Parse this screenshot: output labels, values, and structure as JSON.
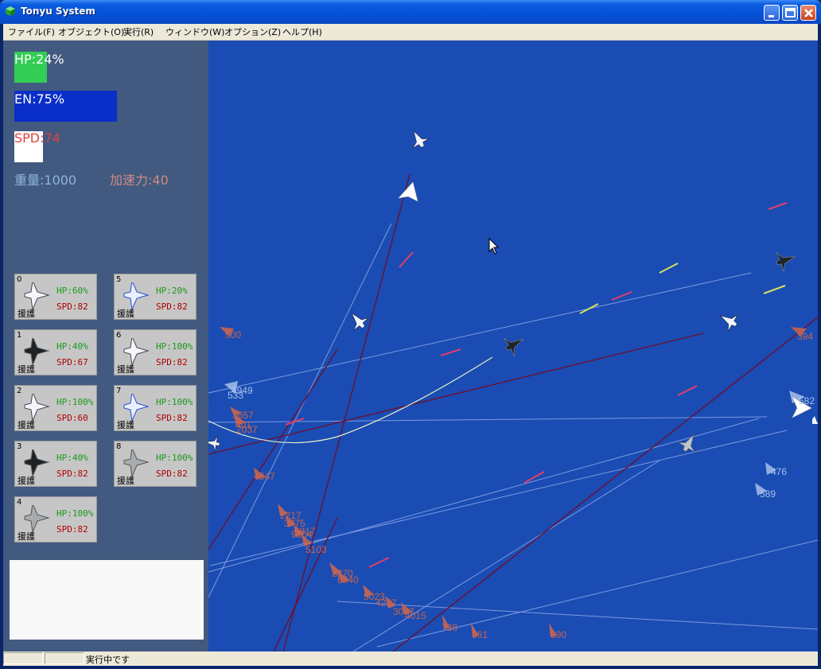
{
  "window": {
    "title": "Tonyu System"
  },
  "menu": [
    {
      "label": "ファイル(F)"
    },
    {
      "label": "オブジェクト(O)"
    },
    {
      "label": "実行(R)"
    },
    {
      "label": "ウィンドウ(W)"
    },
    {
      "label": "オプション(Z)"
    },
    {
      "label": "ヘルプ(H)"
    }
  ],
  "status": {
    "text": "実行中です"
  },
  "hud": {
    "hp": {
      "label": "HP:24%",
      "value": 24,
      "color": "#33cc55"
    },
    "en": {
      "label": "EN:75%",
      "value": 75,
      "color": "#0a2ec8"
    },
    "spd": {
      "label": "SPD:74",
      "value": 74,
      "color": "#ffffff"
    },
    "weight": "重量:1000",
    "accel": "加速力:40"
  },
  "units": [
    {
      "num": "0",
      "hp": "HP:60%",
      "spd": "SPD:82",
      "role": "援護",
      "icon": "white-fighter-icon"
    },
    {
      "num": "5",
      "hp": "HP:20%",
      "spd": "SPD:82",
      "role": "援護",
      "icon": "blue-fighter-icon"
    },
    {
      "num": "1",
      "hp": "HP:40%",
      "spd": "SPD:67",
      "role": "援護",
      "icon": "black-fighter-icon"
    },
    {
      "num": "6",
      "hp": "HP:100%",
      "spd": "SPD:82",
      "role": "援護",
      "icon": "white-fighter-icon"
    },
    {
      "num": "2",
      "hp": "HP:100%",
      "spd": "SPD:60",
      "role": "援護",
      "icon": "white-fighter-icon"
    },
    {
      "num": "7",
      "hp": "HP:100%",
      "spd": "SPD:82",
      "role": "援護",
      "icon": "blue-fighter-icon"
    },
    {
      "num": "3",
      "hp": "HP:40%",
      "spd": "SPD:82",
      "role": "援護",
      "icon": "black-fighter-icon"
    },
    {
      "num": "8",
      "hp": "HP:100%",
      "spd": "SPD:82",
      "role": "援護",
      "icon": "grey-fighter-icon"
    },
    {
      "num": "4",
      "hp": "HP:100%",
      "spd": "SPD:82",
      "role": "援護",
      "icon": "grey-fighter-icon"
    }
  ],
  "damage_labels": [
    "500",
    "533",
    "4949",
    "3657",
    "401",
    "2037",
    "4547",
    "2217",
    "3775",
    "9817",
    "9804",
    "5103",
    "3870",
    "8340",
    "5023",
    "4297",
    "3047",
    "4015",
    "738",
    "861",
    "690",
    "476",
    "589",
    "394",
    "582"
  ],
  "colors": {
    "field": "#1a4cb3",
    "hud_panel": "#425a80",
    "unit_card": "#c6c6c6",
    "damage_label": "#c86450",
    "enemy_label": "#a8c0e8"
  }
}
